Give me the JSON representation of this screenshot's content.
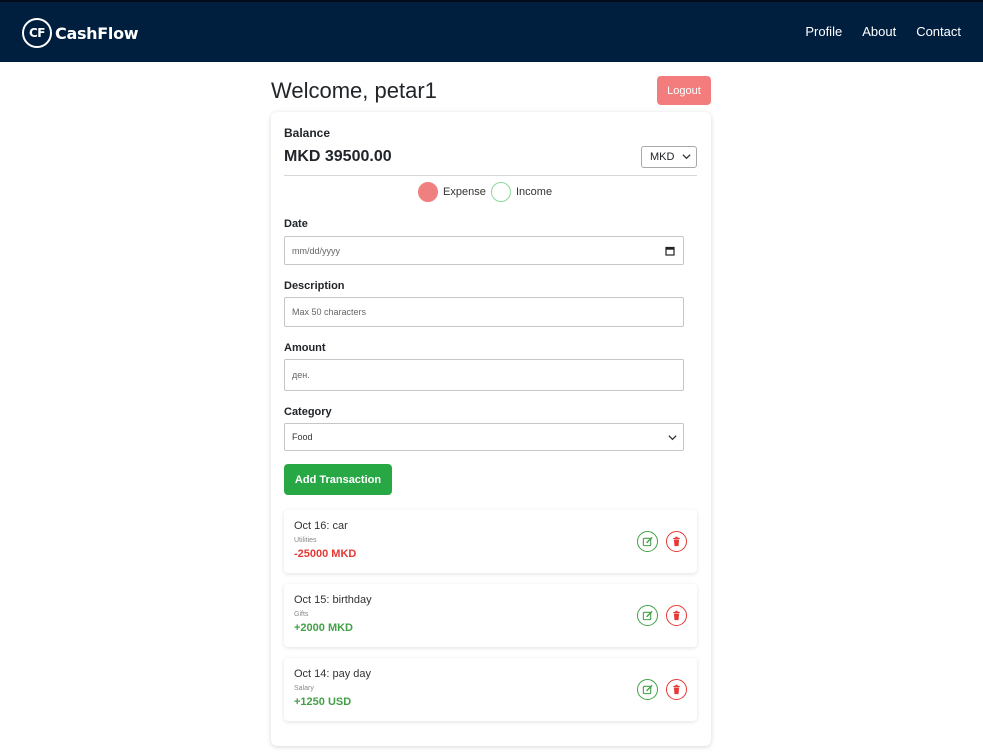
{
  "nav": {
    "logo_text": "CF",
    "brand": "CashFlow",
    "links": [
      "Profile",
      "About",
      "Contact"
    ]
  },
  "header": {
    "welcome": "Welcome, petar1",
    "logout_label": "Logout"
  },
  "balance": {
    "label": "Balance",
    "value": "MKD 39500.00",
    "currency": "MKD"
  },
  "type_toggle": {
    "expense_label": "Expense",
    "income_label": "Income",
    "selected": "Expense"
  },
  "form": {
    "date_label": "Date",
    "date_placeholder": "mm/dd/yyyy",
    "description_label": "Description",
    "description_placeholder": "Max 50 characters",
    "amount_label": "Amount",
    "amount_placeholder": "ден.",
    "category_label": "Category",
    "category_value": "Food",
    "submit_label": "Add Transaction"
  },
  "transactions": [
    {
      "title": "Oct 16: car",
      "category": "Utilities",
      "amount": "-25000 MKD",
      "kind": "expense"
    },
    {
      "title": "Oct 15: birthday",
      "category": "Gifts",
      "amount": "+2000 MKD",
      "kind": "income"
    },
    {
      "title": "Oct 14: pay day",
      "category": "Salary",
      "amount": "+1250 USD",
      "kind": "income"
    }
  ],
  "colors": {
    "navbar": "#001f3f",
    "logout": "#f37c7c",
    "primary_action": "#28a745",
    "expense": "#e53935",
    "income": "#43a047"
  },
  "icons": {
    "edit": "edit-icon",
    "delete": "trash-icon",
    "calendar": "calendar-icon",
    "dropdown": "chevron-down-icon"
  }
}
